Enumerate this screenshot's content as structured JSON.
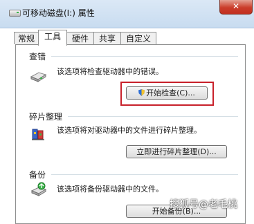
{
  "window": {
    "title": "可移动磁盘(I:) 属性",
    "close_label": "✕"
  },
  "tabs": [
    {
      "label": "常规"
    },
    {
      "label": "工具"
    },
    {
      "label": "硬件"
    },
    {
      "label": "共享"
    },
    {
      "label": "自定义"
    }
  ],
  "active_tab": "工具",
  "error_check": {
    "title": "查错",
    "description": "该选项将检查驱动器中的错误。",
    "button_label": "开始检查(C)...",
    "icon": "disk-check-icon"
  },
  "defrag": {
    "title": "碎片整理",
    "description": "该选项将对驱动器中的文件进行碎片整理。",
    "button_label": "立即进行碎片整理(D)...",
    "icon": "defragment-icon"
  },
  "backup": {
    "title": "备份",
    "description": "该选项将备份驱动器中的文件。",
    "button_label": "开始备份(B)...",
    "icon": "backup-icon"
  },
  "watermark": "搜狐号@老毛桃",
  "colors": {
    "highlight_box": "#c8202a",
    "title_bar": "#c8dcf0",
    "close_button": "#cb3d2b"
  }
}
